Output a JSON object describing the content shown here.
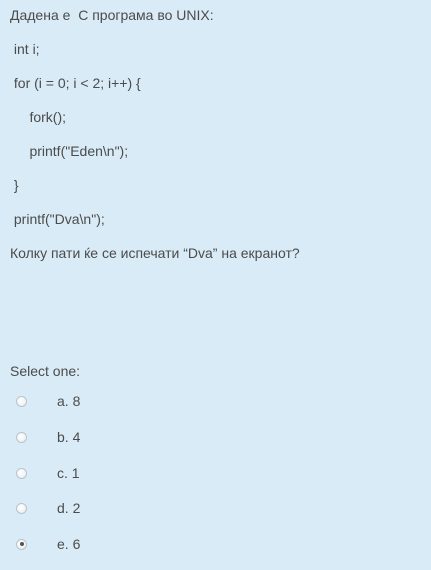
{
  "question": {
    "lines": [
      "Дадена е  C програма во UNIX:",
      " int i;",
      " for (i = 0; i < 2; i++) {",
      "     fork();",
      "     printf(\"Eden\\n\");",
      " }",
      " printf(\"Dva\\n\");",
      "Колку пати ќе се испечати “Dva” на екранот?"
    ]
  },
  "answer": {
    "select_label": "Select one:",
    "options": [
      {
        "label": "a. 8",
        "checked": false
      },
      {
        "label": "b. 4",
        "checked": false
      },
      {
        "label": "c. 1",
        "checked": false
      },
      {
        "label": "d. 2",
        "checked": false
      },
      {
        "label": "e. 6",
        "checked": true
      }
    ]
  }
}
